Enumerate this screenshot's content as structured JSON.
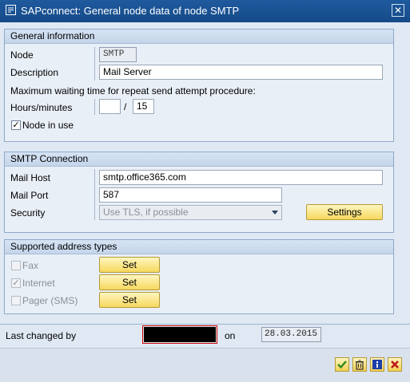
{
  "window": {
    "title": "SAPconnect: General node data of node SMTP",
    "close_symbol": "✕"
  },
  "general": {
    "header": "General information",
    "node_label": "Node",
    "node_value": "SMTP",
    "description_label": "Description",
    "description_value": "Mail Server",
    "max_wait_text": "Maximum waiting time for repeat send attempt procedure:",
    "hours_label": "Hours/minutes",
    "hours_value": "",
    "separator": "/",
    "minutes_value": "15",
    "node_in_use_label": "Node in use",
    "node_in_use_checked": true
  },
  "smtp": {
    "header": "SMTP Connection",
    "mail_host_label": "Mail Host",
    "mail_host_value": "smtp.office365.com",
    "mail_port_label": "Mail Port",
    "mail_port_value": "587",
    "security_label": "Security",
    "security_value": "Use TLS, if possible",
    "settings_button": "Settings"
  },
  "address_types": {
    "header": "Supported address types",
    "items": [
      {
        "label": "Fax",
        "checked": false,
        "button": "Set"
      },
      {
        "label": "Internet",
        "checked": true,
        "button": "Set"
      },
      {
        "label": "Pager (SMS)",
        "checked": false,
        "button": "Set"
      }
    ]
  },
  "changed": {
    "last_changed_by_label": "Last changed by",
    "on_label": "on",
    "date_value": "28.03.2015"
  },
  "toolbar": {
    "icons": [
      "checkmark-icon",
      "trash-icon",
      "info-icon",
      "cancel-icon"
    ]
  },
  "colors": {
    "accent_title": "#1f5a9e",
    "button_yellow": "#f6d85e",
    "cancel_red": "#c0181b",
    "confirm_green": "#2f8a1e",
    "info_blue": "#1c3ea8"
  }
}
